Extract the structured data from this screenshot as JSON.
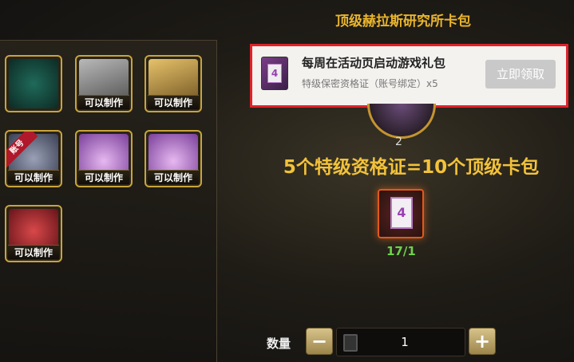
{
  "title": "顶级赫拉斯研究所卡包",
  "items": [
    {
      "name": "item-1",
      "tag": ""
    },
    {
      "name": "item-2",
      "tag": "可以制作"
    },
    {
      "name": "item-3",
      "tag": "可以制作"
    },
    {
      "name": "item-4",
      "tag": "可以制作",
      "badge": "账号"
    },
    {
      "name": "item-5",
      "tag": "可以制作"
    },
    {
      "name": "item-6",
      "tag": "可以制作"
    },
    {
      "name": "item-7",
      "tag": "可以制作"
    }
  ],
  "notice": {
    "title": "每周在活动页启动游戏礼包",
    "subtitle": "特级保密资格证（账号绑定）x5",
    "button": "立即领取",
    "icon_label": "4"
  },
  "ring_count": "2",
  "formula": "5个特级资格证=10个顶级卡包",
  "card": {
    "label": "4",
    "count": "17/1"
  },
  "quantity": {
    "label": "数量",
    "minus": "−",
    "plus": "+",
    "value": "1"
  },
  "colors": {
    "gold": "#e9b52e",
    "green": "#6fd24a",
    "red_border": "#e0222a"
  }
}
